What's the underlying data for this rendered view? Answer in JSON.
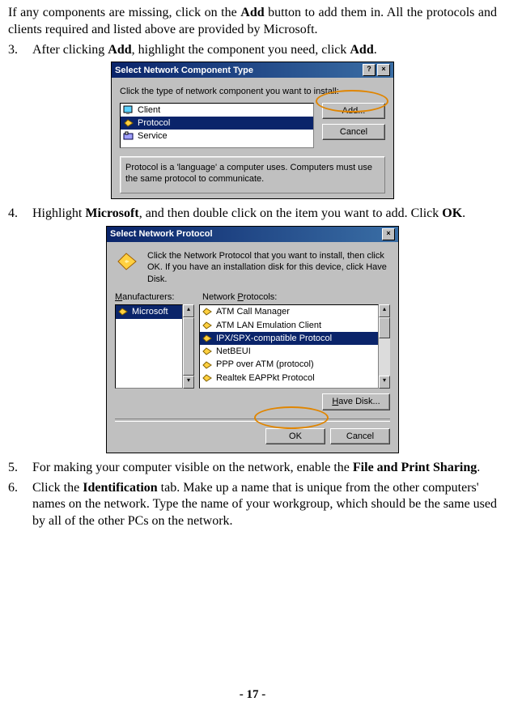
{
  "intro": {
    "prefix": "If any components are missing, click on the ",
    "b1": "Add",
    "mid": " button to add them in. All the protocols and clients required and listed above are provided by Microsoft."
  },
  "steps": {
    "s3": {
      "num": "3.",
      "t1": "After clicking ",
      "b1": "Add",
      "t2": ", highlight the component you need, click ",
      "b2": "Add",
      "t3": "."
    },
    "s4": {
      "num": "4.",
      "t1": "Highlight ",
      "b1": "Microsoft",
      "t2": ", and then double click on the item you want to add. Click ",
      "b2": "OK",
      "t3": "."
    },
    "s5": {
      "num": "5.",
      "t1": "For making your computer visible on the network, enable the ",
      "b1": "File and Print Sharing",
      "t2": "."
    },
    "s6": {
      "num": "6.",
      "t1": "Click the ",
      "b1": "Identification",
      "t2": " tab. Make up a name that is unique from the other computers' names on the network.    Type the name of your workgroup, which should be the same used by all of the other PCs on the network."
    }
  },
  "dlg1": {
    "title": "Select Network Component Type",
    "prompt": "Click the type of network component you want to install:",
    "items": [
      "Client",
      "Protocol",
      "Service"
    ],
    "btn_add": "Add...",
    "btn_cancel": "Cancel",
    "desc": "Protocol is a 'language' a computer uses. Computers must use the same protocol to communicate."
  },
  "dlg2": {
    "title": "Select Network Protocol",
    "prompt": "Click the Network Protocol that you want to install, then click OK. If you have an installation disk for this device, click Have Disk.",
    "lbl_m": "Manufacturers:",
    "lbl_p": "Network Protocols:",
    "manufacturers": [
      "Microsoft"
    ],
    "protocols": [
      "ATM Call Manager",
      "ATM LAN Emulation Client",
      "IPX/SPX-compatible Protocol",
      "NetBEUI",
      "PPP over ATM (protocol)",
      "Realtek EAPPkt Protocol"
    ],
    "btn_havedisk": "Have Disk...",
    "btn_ok": "OK",
    "btn_cancel": "Cancel"
  },
  "footer": "- 17 -"
}
